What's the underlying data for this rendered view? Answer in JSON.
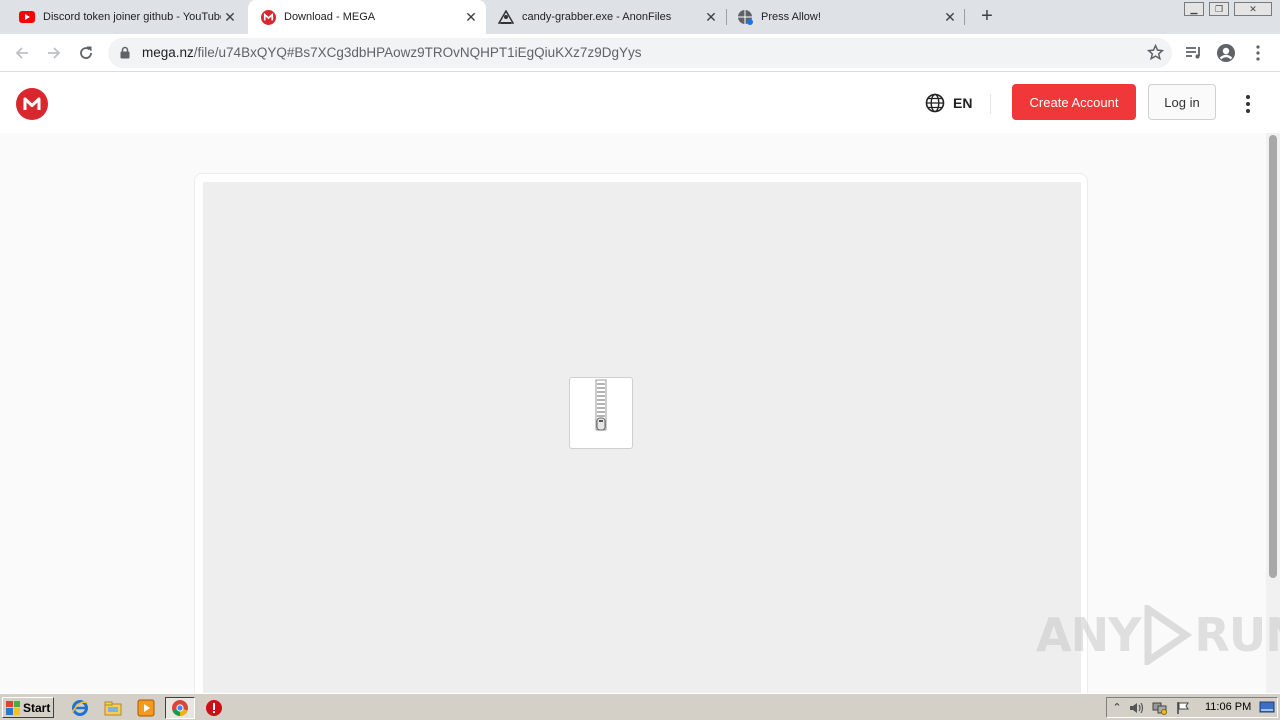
{
  "browser": {
    "tabs": [
      {
        "title": "Discord token joiner github - YouTube",
        "icon": "youtube-icon",
        "active": false
      },
      {
        "title": "Download - MEGA",
        "icon": "mega-icon",
        "active": true
      },
      {
        "title": "candy-grabber.exe - AnonFiles",
        "icon": "anonfiles-icon",
        "active": false
      },
      {
        "title": "Press Allow!",
        "icon": "globe-icon",
        "active": false
      }
    ],
    "new_tab_glyph": "+",
    "close_glyph": "✕",
    "url_host": "mega.nz",
    "url_path": "/file/u74BxQYQ#Bs7XCg3dbHPAowz9TROvNQHPT1iEgQiuKXz7z9DgYys"
  },
  "mega": {
    "logo_letter": "M",
    "lang_label": "EN",
    "create_account_label": "Create Account",
    "login_label": "Log in",
    "brand_color": "#d9272e",
    "create_button_color": "#f0373a"
  },
  "watermark": {
    "left": "ANY",
    "right": "RUN"
  },
  "taskbar": {
    "start_label": "Start",
    "clock": "11:06 PM"
  }
}
